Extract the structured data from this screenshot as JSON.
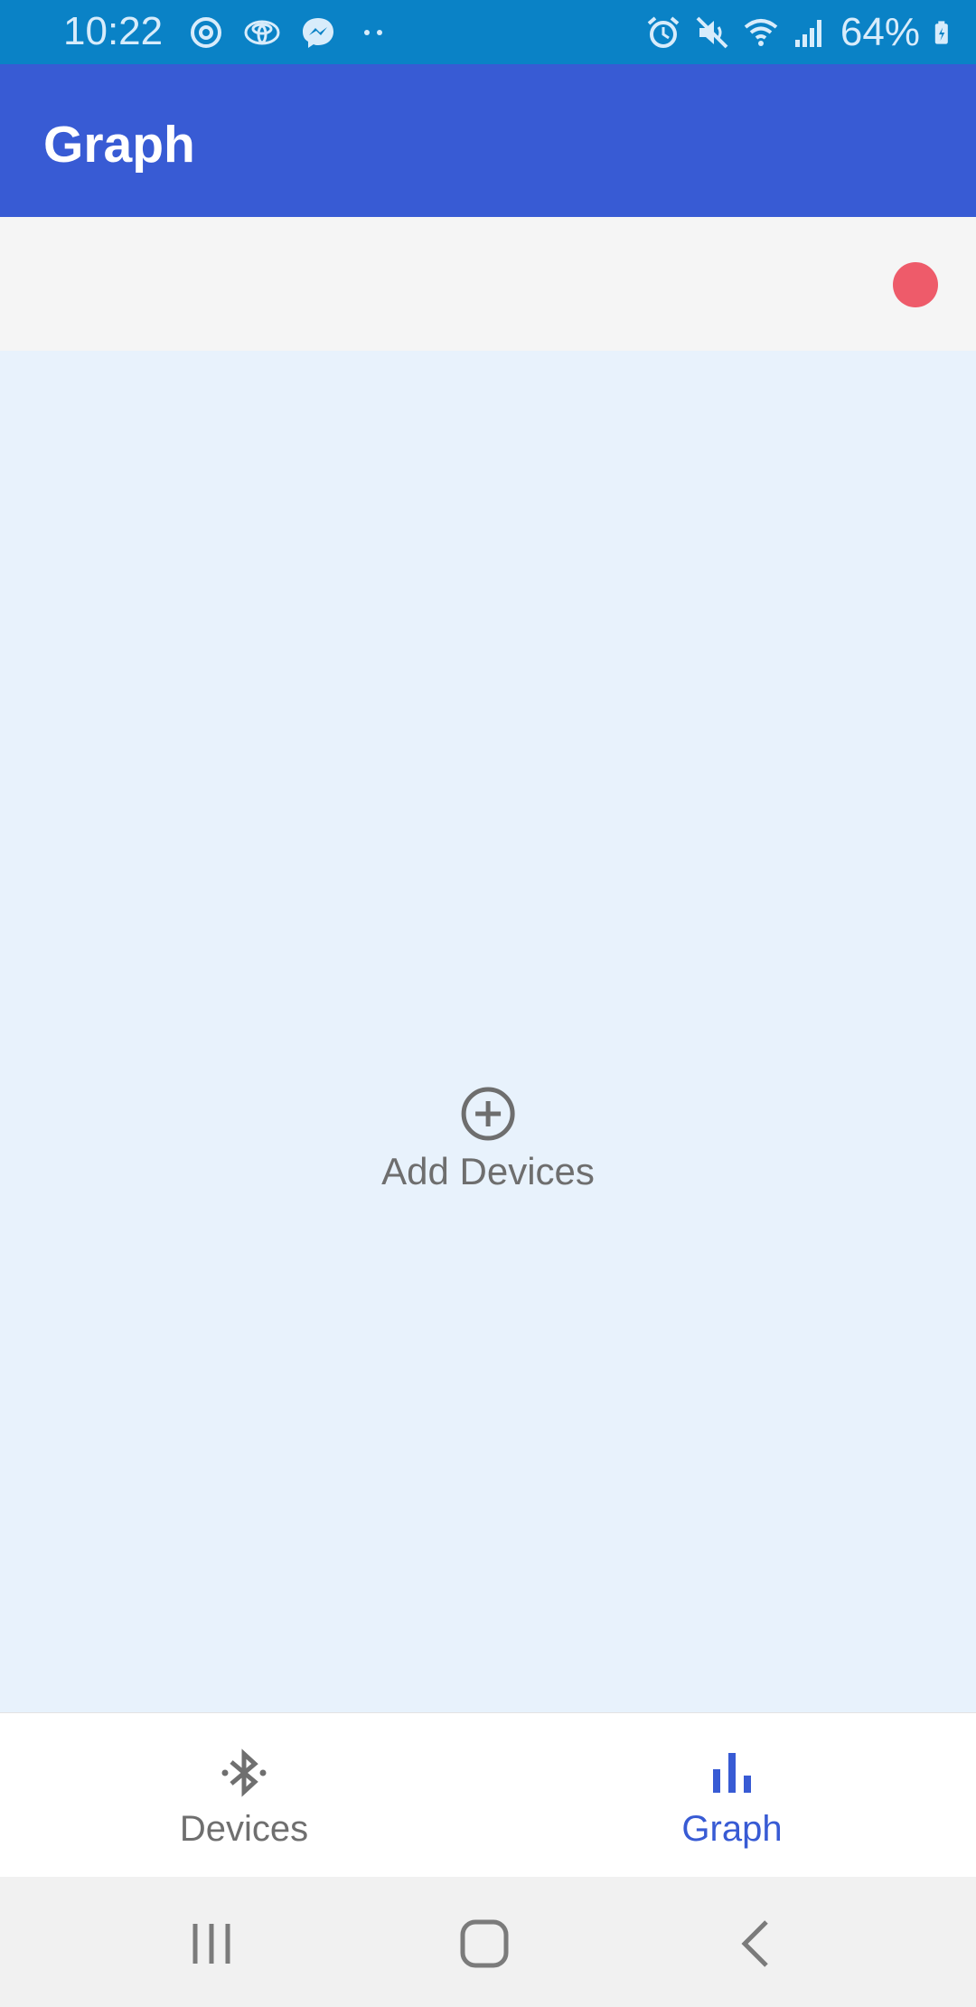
{
  "status_bar": {
    "time": "10:22",
    "battery": "64%",
    "left_icons": [
      "sync-icon",
      "toyota-icon",
      "messenger-icon",
      "more-dots-icon"
    ],
    "right_icons": [
      "alarm-icon",
      "mute-icon",
      "wifi-icon",
      "signal-icon",
      "battery-icon"
    ]
  },
  "app_bar": {
    "title": "Graph"
  },
  "toolbar": {
    "record_indicator": "record-dot-icon",
    "record_color": "#ee5b6a"
  },
  "main": {
    "add_devices_label": "Add Devices",
    "add_icon": "add-circle-icon"
  },
  "bottom_nav": {
    "items": [
      {
        "label": "Devices",
        "icon": "bluetooth-icon",
        "active": false
      },
      {
        "label": "Graph",
        "icon": "bar-chart-icon",
        "active": true
      }
    ]
  },
  "colors": {
    "status_bar": "#0a82c6",
    "app_bar": "#385bd4",
    "main_background": "#e8f2fc",
    "active_nav": "#385bd4",
    "inactive_nav": "#6f6f6f"
  }
}
